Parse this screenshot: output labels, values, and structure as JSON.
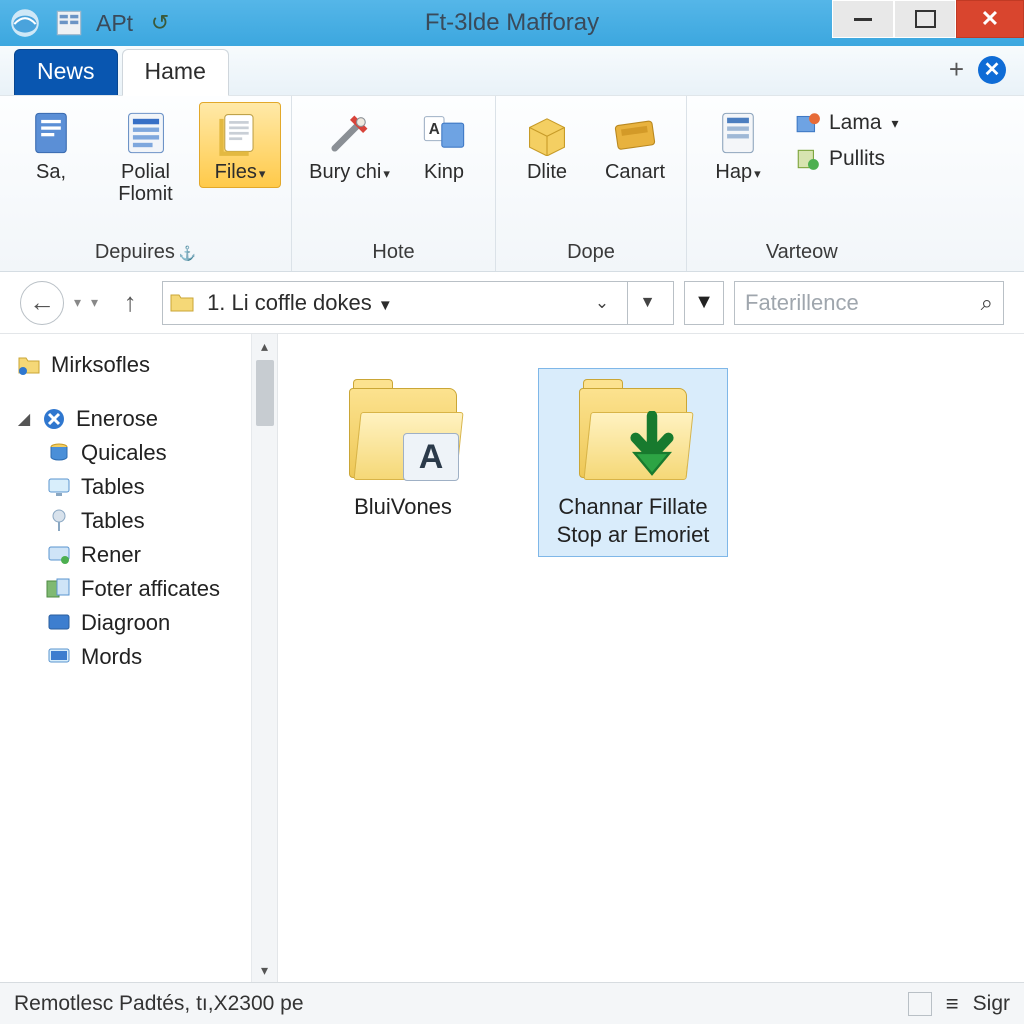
{
  "titlebar": {
    "title": "Ft-3lde Mafforay",
    "qat_label": "APt"
  },
  "tabs": {
    "news": "News",
    "home": "Hame"
  },
  "ribbon": {
    "groups": [
      {
        "caption": "Depuires",
        "items": [
          {
            "label": "Sa,",
            "icon": "doc"
          },
          {
            "label": "Polial Flomit",
            "icon": "list"
          },
          {
            "label": "Files",
            "icon": "file",
            "selected": true,
            "drop": true
          }
        ]
      },
      {
        "caption": "Hote",
        "items": [
          {
            "label": "Bury chi",
            "icon": "tools",
            "drop": true
          },
          {
            "label": "Kinp",
            "icon": "rename"
          }
        ]
      },
      {
        "caption": "Dope",
        "items": [
          {
            "label": "Dlite",
            "icon": "box"
          },
          {
            "label": "Canart",
            "icon": "pack"
          }
        ]
      },
      {
        "caption": "Varteow",
        "big": {
          "label": "Hap",
          "drop": true
        },
        "side": [
          {
            "label": "Lama",
            "drop": true
          },
          {
            "label": "Pullits"
          }
        ]
      }
    ]
  },
  "nav": {
    "path": "1. Li coffle dokes",
    "search_placeholder": "Faterillence"
  },
  "sidebar": {
    "top": "Mirksofles",
    "group": "Enerose",
    "items": [
      "Quicales",
      "Tables",
      "Tables",
      "Rener",
      "Foter afficates",
      "Diagroon",
      "Mords"
    ]
  },
  "main": {
    "items": [
      {
        "label": "BluiVones",
        "selected": false
      },
      {
        "label": "Channar Fillate Stop ar Emoriet",
        "selected": true
      }
    ]
  },
  "statusbar": {
    "left": "Remotlesc Padtés, tı,X2300 pe",
    "right": "Sigr"
  }
}
